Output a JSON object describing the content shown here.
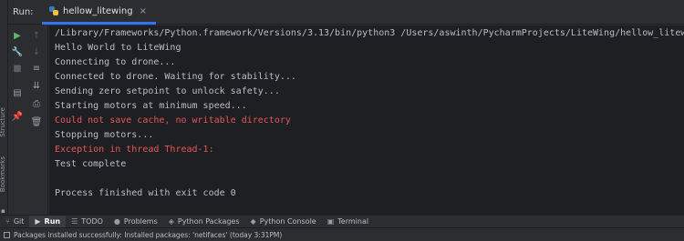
{
  "header": {
    "run_label": "Run:",
    "tab_label": "hellow_litewing",
    "tab_close": "×"
  },
  "left_stripe": {
    "structure_label": "Structure",
    "bookmarks_label": "Bookmarks"
  },
  "toolbar": {
    "icons": [
      "run-icon",
      "scroll-up-icon",
      "wrench-icon",
      "scroll-down-icon",
      "stop-icon",
      "soft-wrap-icon",
      "layout-icon",
      "scroll-to-end-icon",
      "pin-icon",
      "print-icon",
      "trash-icon"
    ]
  },
  "console": {
    "lines": [
      {
        "text": "/Library/Frameworks/Python.framework/Versions/3.13/bin/python3 /Users/aswinth/PycharmProjects/LiteWing/hellow_litewing.py",
        "type": "normal"
      },
      {
        "text": "Hello World to LiteWing",
        "type": "normal"
      },
      {
        "text": "Connecting to drone...",
        "type": "normal"
      },
      {
        "text": "Connected to drone. Waiting for stability...",
        "type": "normal"
      },
      {
        "text": "Sending zero setpoint to unlock safety...",
        "type": "normal"
      },
      {
        "text": "Starting motors at minimum speed...",
        "type": "normal"
      },
      {
        "text": "Could not save cache, no writable directory",
        "type": "error"
      },
      {
        "text": "Stopping motors...",
        "type": "normal"
      },
      {
        "text": "Exception in thread Thread-1:",
        "type": "error"
      },
      {
        "text": "Test complete",
        "type": "normal"
      },
      {
        "text": "",
        "type": "normal"
      },
      {
        "text": "Process finished with exit code 0",
        "type": "normal"
      }
    ],
    "error_color": "#e85656",
    "text_color": "#bcbec4"
  },
  "bottom_bar": {
    "git": "Git",
    "run": "Run",
    "todo": "TODO",
    "problems": "Problems",
    "python_packages": "Python Packages",
    "python_console": "Python Console",
    "terminal": "Terminal"
  },
  "status": {
    "message": "Packages installed successfully: Installed packages: 'netifaces' (today 3:31PM)"
  },
  "colors": {
    "accent": "#3574f0",
    "run_green": "#5fb865"
  }
}
